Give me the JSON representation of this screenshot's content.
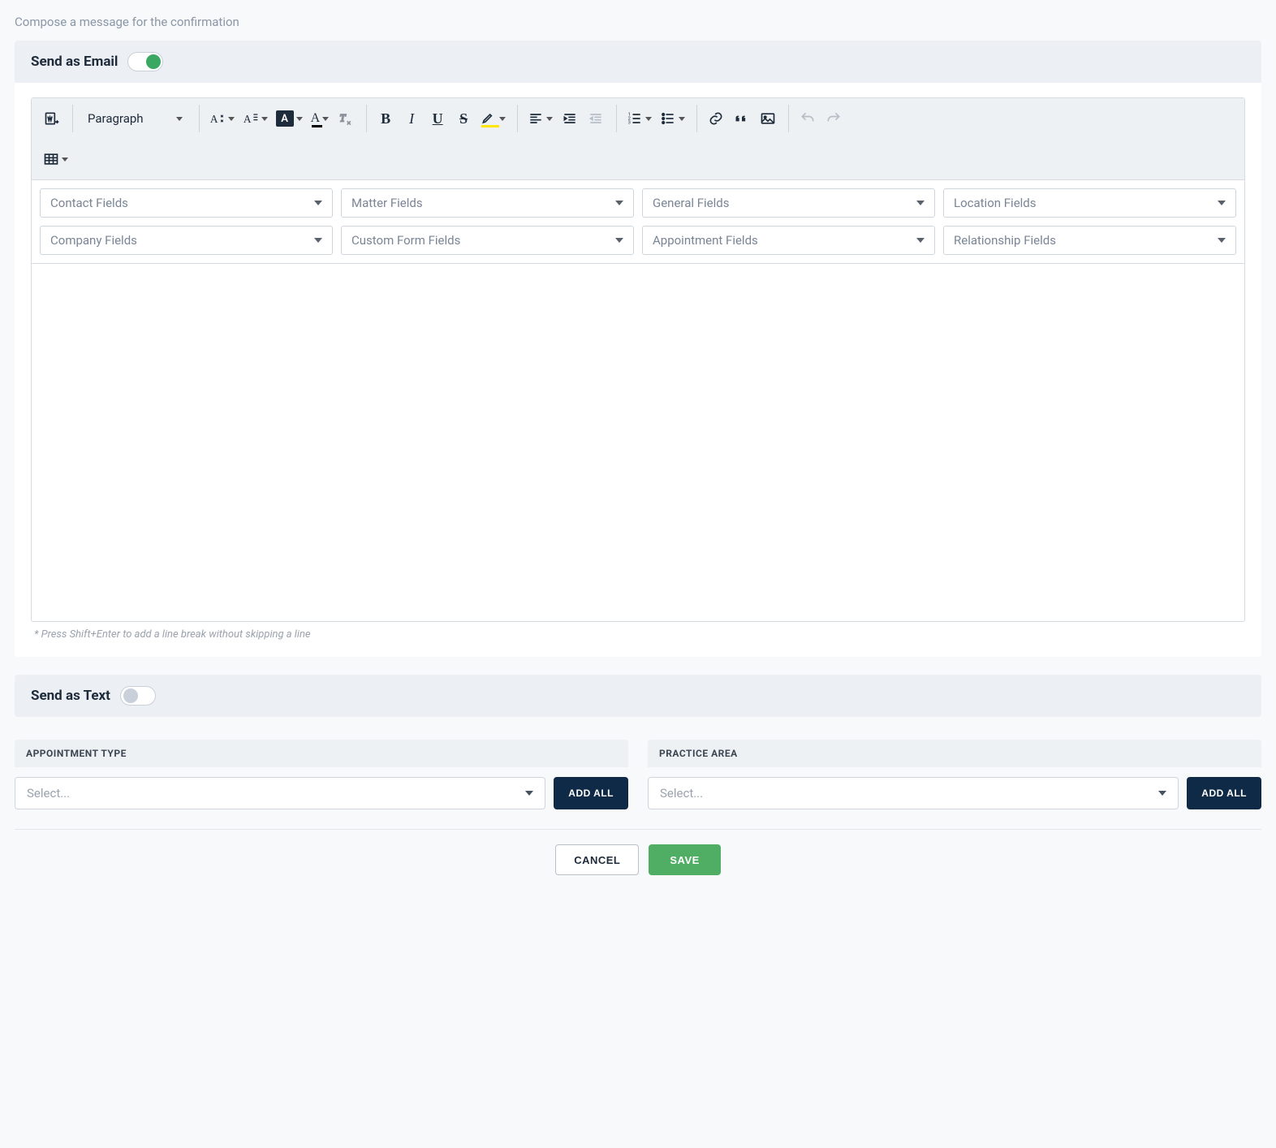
{
  "page": {
    "subtitle": "Compose a message for the confirmation"
  },
  "email_section": {
    "title": "Send as Email",
    "toggle_on": true
  },
  "text_section": {
    "title": "Send as Text",
    "toggle_on": false
  },
  "toolbar": {
    "paragraph_label": "Paragraph"
  },
  "field_dropdowns": [
    "Contact Fields",
    "Matter Fields",
    "General Fields",
    "Location Fields",
    "Company Fields",
    "Custom Form Fields",
    "Appointment Fields",
    "Relationship Fields"
  ],
  "editor": {
    "hint": "* Press Shift+Enter to add a line break without skipping a line"
  },
  "appointment_type": {
    "header": "APPOINTMENT TYPE",
    "placeholder": "Select...",
    "add_all_label": "ADD ALL"
  },
  "practice_area": {
    "header": "PRACTICE AREA",
    "placeholder": "Select...",
    "add_all_label": "ADD ALL"
  },
  "footer": {
    "cancel": "CANCEL",
    "save": "SAVE"
  }
}
